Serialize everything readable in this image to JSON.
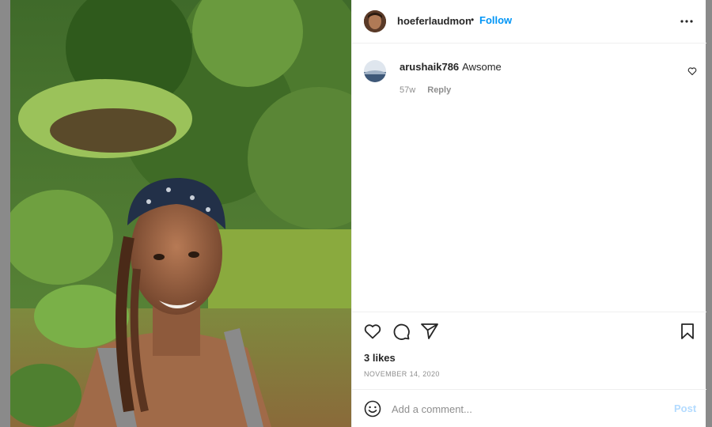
{
  "post": {
    "author": "hoeferlaudmon",
    "separator": "•",
    "follow_label": "Follow",
    "more_icon": "more-horizontal-icon"
  },
  "comments": [
    {
      "username": "arushaik786",
      "text": "Awsome",
      "age": "57w",
      "reply_label": "Reply"
    }
  ],
  "actions": {
    "icons": [
      "heart-icon",
      "comment-icon",
      "share-icon",
      "bookmark-icon"
    ],
    "likes": "3 likes",
    "date": "NOVEMBER 14, 2020"
  },
  "composer": {
    "placeholder": "Add a comment...",
    "post_label": "Post"
  },
  "colors": {
    "accent": "#0095f6",
    "post_disabled": "#b3dbff",
    "muted": "#8e8e8e",
    "text": "#262626"
  }
}
